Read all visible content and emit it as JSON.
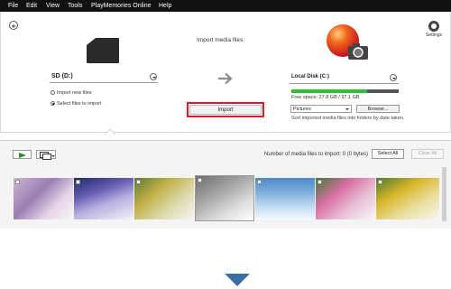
{
  "menu": [
    "File",
    "Edit",
    "View",
    "Tools",
    "PlayMemories Online",
    "Help"
  ],
  "header": {
    "title": "Import media files.",
    "settings_label": "Settings"
  },
  "source": {
    "drive": "SD (D:)",
    "options": [
      "Import new files",
      "Select files to import"
    ],
    "selected_option": "Select files to import"
  },
  "import_button": "Import",
  "destination": {
    "drive": "Local Disk (C:)",
    "used_fraction": 0.71,
    "free_space": "Free space: 27.8 GB / 97.1 GB",
    "folder": "Pictures",
    "browse": "Browse...",
    "sort_note": "Sort imported media files into folders by date taken."
  },
  "toolbar": {
    "count_text": "Number of media files to import: 0 (0 bytes)",
    "select_all": "Select All",
    "clear_all": "Clear All"
  },
  "thumbnails": [
    "purple-flowers",
    "city-lights",
    "yellow-fruit",
    "cat",
    "sky-ocean",
    "flower-bouquet",
    "sunflowers"
  ],
  "colors": {
    "menubar": "#111111",
    "import_highlight": "#d21f28",
    "space_bar": "#2bbf3a",
    "arrow": "#3b6ea3"
  }
}
